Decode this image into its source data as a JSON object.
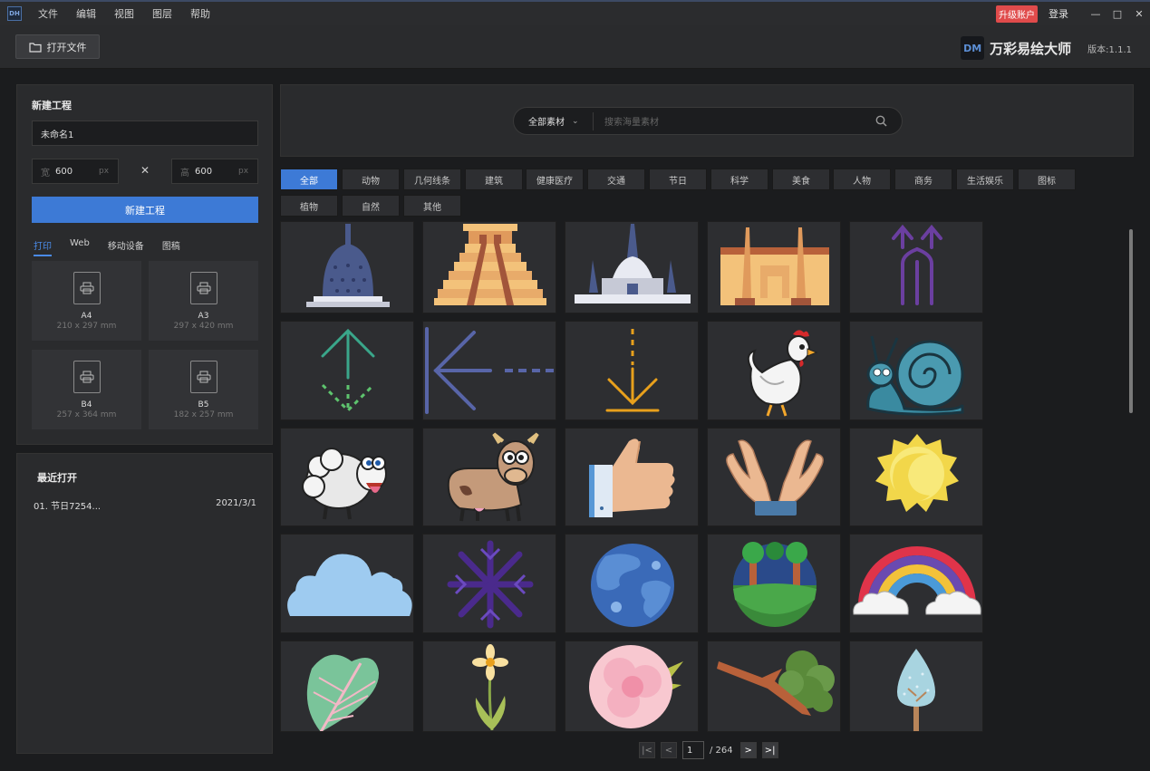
{
  "app": {
    "logo_text": "DH"
  },
  "menu": [
    "文件",
    "编辑",
    "视图",
    "图层",
    "帮助"
  ],
  "account": {
    "upgrade": "升级账户",
    "login": "登录"
  },
  "window_controls": {
    "minimize": "—",
    "maximize": "□",
    "close": "✕"
  },
  "toolbar": {
    "open_file": "打开文件"
  },
  "brand": {
    "logo": "DM",
    "name": "万彩易绘大师",
    "version": "版本:1.1.1"
  },
  "new_project": {
    "title": "新建工程",
    "name_value": "未命名1",
    "width_label": "宽",
    "width_value": "600",
    "height_label": "高",
    "height_value": "600",
    "unit": "px",
    "times": "✕",
    "create_button": "新建工程",
    "tabs": [
      "打印",
      "Web",
      "移动设备",
      "图稿"
    ],
    "active_tab": "打印",
    "papers": [
      {
        "name": "A4",
        "size": "210 x 297 mm"
      },
      {
        "name": "A3",
        "size": "297 x 420 mm"
      },
      {
        "name": "B4",
        "size": "257 x 364 mm"
      },
      {
        "name": "B5",
        "size": "182 x 257 mm"
      }
    ]
  },
  "recent": {
    "title": "最近打开",
    "items": [
      {
        "name": "01. 节日7254...",
        "date": "2021/3/1"
      }
    ]
  },
  "search": {
    "category": "全部素材",
    "placeholder": "搜索海量素材"
  },
  "categories": [
    "全部",
    "动物",
    "几何线条",
    "建筑",
    "健康医疗",
    "交通",
    "节日",
    "科学",
    "美食",
    "人物",
    "商务",
    "生活娱乐",
    "图标",
    "植物",
    "自然",
    "其他"
  ],
  "active_category": "全部",
  "assets": [
    "stupa",
    "pyramid",
    "temple",
    "fortress",
    "arrow-trident",
    "arrow-up",
    "arrow-left",
    "arrow-down",
    "chicken",
    "snail",
    "sheep",
    "cow",
    "thumbs-up",
    "hands",
    "sun",
    "cloud",
    "snowflake",
    "planet",
    "forest-circle",
    "rainbow",
    "leaf",
    "flower-yellow",
    "flower-pink",
    "branch",
    "tree"
  ],
  "pagination": {
    "current": "1",
    "total": "/ 264"
  }
}
